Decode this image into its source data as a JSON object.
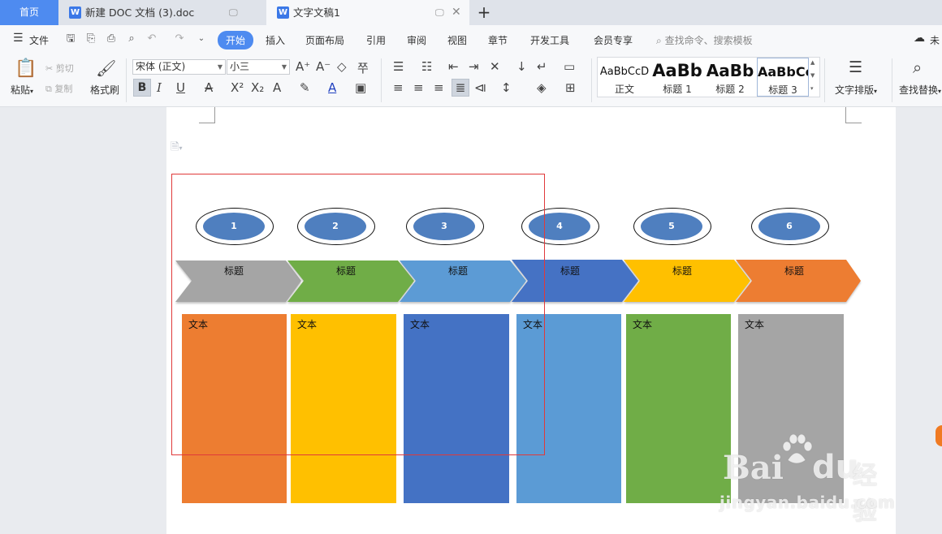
{
  "tabs": {
    "home": "首页",
    "doc1": "新建 DOC 文档 (3).doc",
    "doc2": "文字文稿1",
    "new_tab": "+"
  },
  "menu": {
    "file": "文件",
    "items": [
      "开始",
      "插入",
      "页面布局",
      "引用",
      "审阅",
      "视图",
      "章节",
      "开发工具",
      "会员专享"
    ],
    "search": "查找命令、搜索模板",
    "right_label": "未"
  },
  "ribbon": {
    "paste": "粘贴",
    "cut": "剪切",
    "copy": "复制",
    "format_painter": "格式刷",
    "font_name": "宋体 (正文)",
    "font_size": "小三",
    "styles": [
      {
        "sample": "AaBbCcD",
        "name": "正文"
      },
      {
        "sample": "AaBb",
        "name": "标题 1"
      },
      {
        "sample": "AaBb",
        "name": "标题 2"
      },
      {
        "sample": "AaBbCc",
        "name": "标题 3"
      }
    ],
    "text_layout": "文字排版",
    "find_replace": "查找替换"
  },
  "diagram": {
    "numbers": [
      "1",
      "2",
      "3",
      "4",
      "5",
      "6"
    ],
    "chevron_label": "标题",
    "box_label": "文本",
    "colors": [
      "#a5a5a5",
      "#70ad47",
      "#5b9bd5",
      "#4472c4",
      "#ffc000",
      "#ed7d31"
    ],
    "box_colors": [
      "#ed7d31",
      "#ffc000",
      "#4472c4",
      "#5b9bd5",
      "#70ad47",
      "#a5a5a5"
    ]
  },
  "watermark": {
    "brand": "Bai",
    "brand2": "经验",
    "url": "jingyan.baidu.com"
  }
}
